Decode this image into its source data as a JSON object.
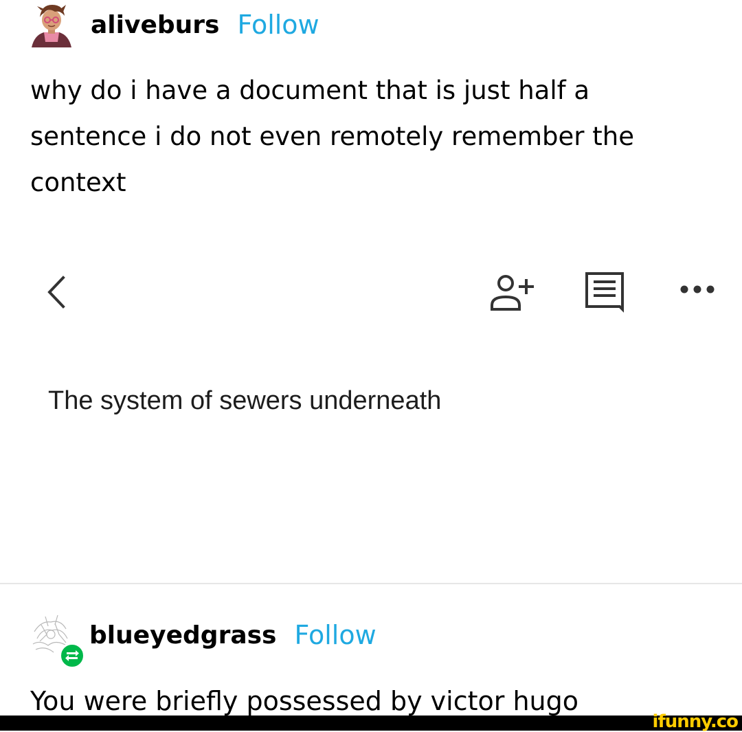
{
  "colors": {
    "follow": "#1fa9e1",
    "text": "#000000",
    "icon": "#333333",
    "reblog_badge": "#00b84a",
    "watermark": "#ffcc00",
    "watermark_bar": "#000000"
  },
  "post1": {
    "username": "aliveburs",
    "follow_label": "Follow",
    "avatar_icon": "user-avatar-illustration-icon",
    "text": "why do i have a document that is just half a\nsentence i do not even remotely remember the\ncontext"
  },
  "screenshot": {
    "toolbar": {
      "back_icon": "chevron-left-icon",
      "add_person_icon": "add-person-icon",
      "comment_icon": "comment-icon",
      "more_icon": "more-horizontal-icon"
    },
    "document_text": "The system of sewers underneath"
  },
  "post2": {
    "username": "blueyedgrass",
    "follow_label": "Follow",
    "avatar_icon": "sketch-avatar-icon",
    "reblog_icon": "reblog-icon",
    "text": "You were briefly possessed by victor hugo"
  },
  "watermark": {
    "text": "ifunny.co"
  }
}
